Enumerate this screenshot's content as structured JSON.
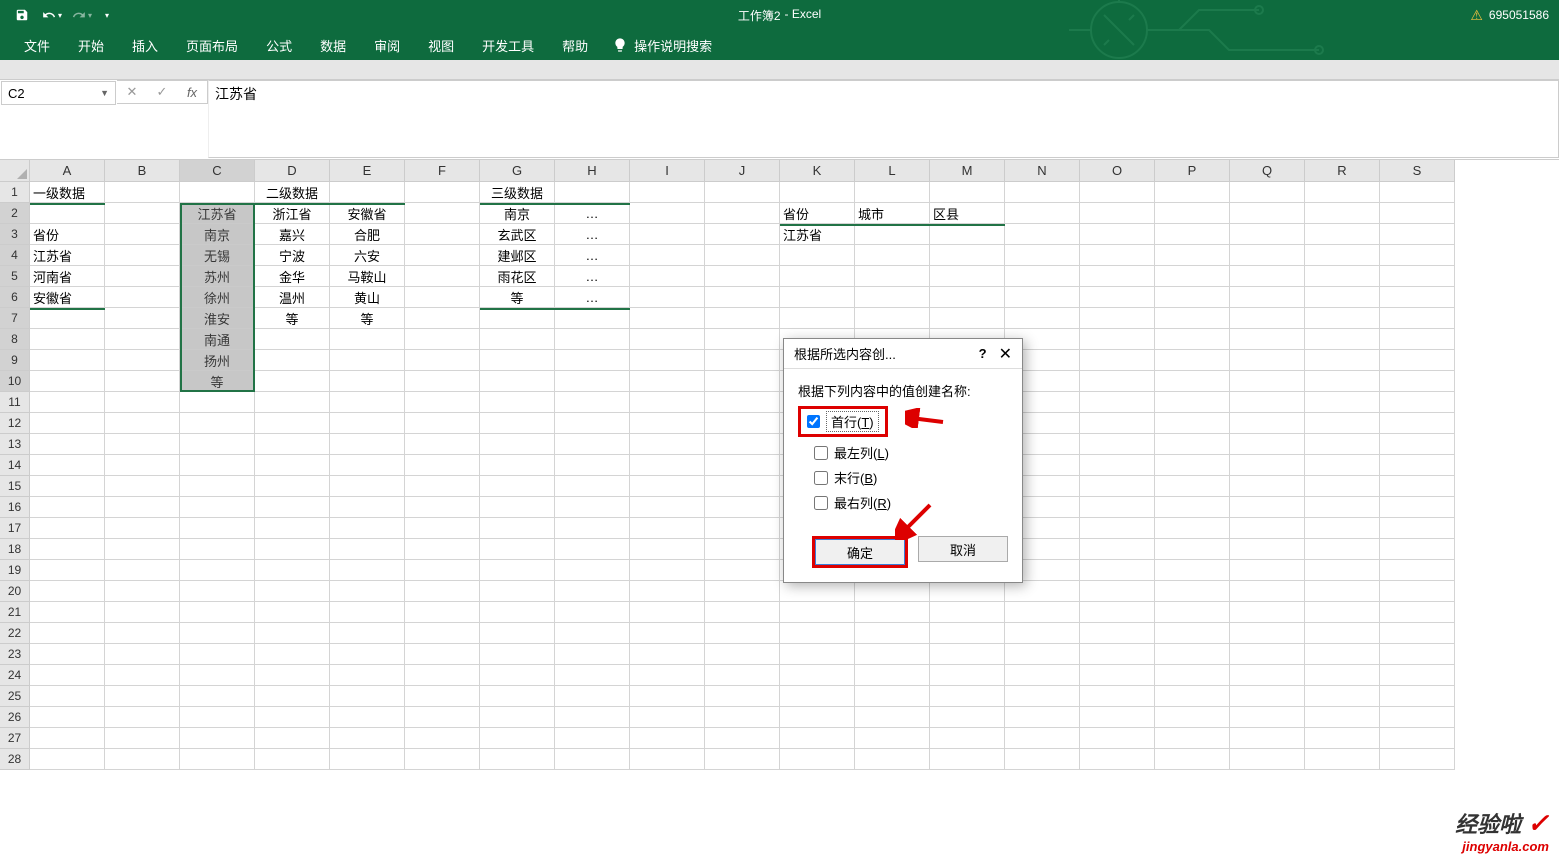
{
  "title_bar": {
    "doc_name": "工作簿2",
    "app_name": "- Excel",
    "user_id": "695051586"
  },
  "ribbon": {
    "tabs": [
      "文件",
      "开始",
      "插入",
      "页面布局",
      "公式",
      "数据",
      "审阅",
      "视图",
      "开发工具",
      "帮助"
    ],
    "help_search": "操作说明搜索"
  },
  "formula_bar": {
    "name_box": "C2",
    "formula": "江苏省"
  },
  "columns": [
    "A",
    "B",
    "C",
    "D",
    "E",
    "F",
    "G",
    "H",
    "I",
    "J",
    "K",
    "L",
    "M",
    "N",
    "O",
    "P",
    "Q",
    "R",
    "S"
  ],
  "rows_count": 28,
  "sheet": {
    "A1": "一级数据",
    "D1": "二级数据",
    "G1": "三级数据",
    "A3": "省份",
    "A4": "江苏省",
    "A5": "河南省",
    "A6": "安徽省",
    "C2": "江苏省",
    "D2": "浙江省",
    "E2": "安徽省",
    "C3": "南京",
    "D3": "嘉兴",
    "E3": "合肥",
    "C4": "无锡",
    "D4": "宁波",
    "E4": "六安",
    "C5": "苏州",
    "D5": "金华",
    "E5": "马鞍山",
    "C6": "徐州",
    "D6": "温州",
    "E6": "黄山",
    "C7": "淮安",
    "D7": "等",
    "E7": "等",
    "C8": "南通",
    "C9": "扬州",
    "C10": "等",
    "G2": "南京",
    "H2": "…",
    "G3": "玄武区",
    "H3": "…",
    "G4": "建邺区",
    "H4": "…",
    "G5": "雨花区",
    "H5": "…",
    "G6": "等",
    "H6": "…",
    "K2": "省份",
    "L2": "城市",
    "M2": "区县",
    "K3": "江苏省"
  },
  "dialog": {
    "title": "根据所选内容创...",
    "prompt": "根据下列内容中的值创建名称:",
    "opt_top": "首行(T)",
    "opt_left": "最左列(L)",
    "opt_bottom": "末行(B)",
    "opt_right": "最右列(R)",
    "ok": "确定",
    "cancel": "取消"
  },
  "watermark": {
    "text": "经验啦",
    "url": "jingyanla.com"
  }
}
